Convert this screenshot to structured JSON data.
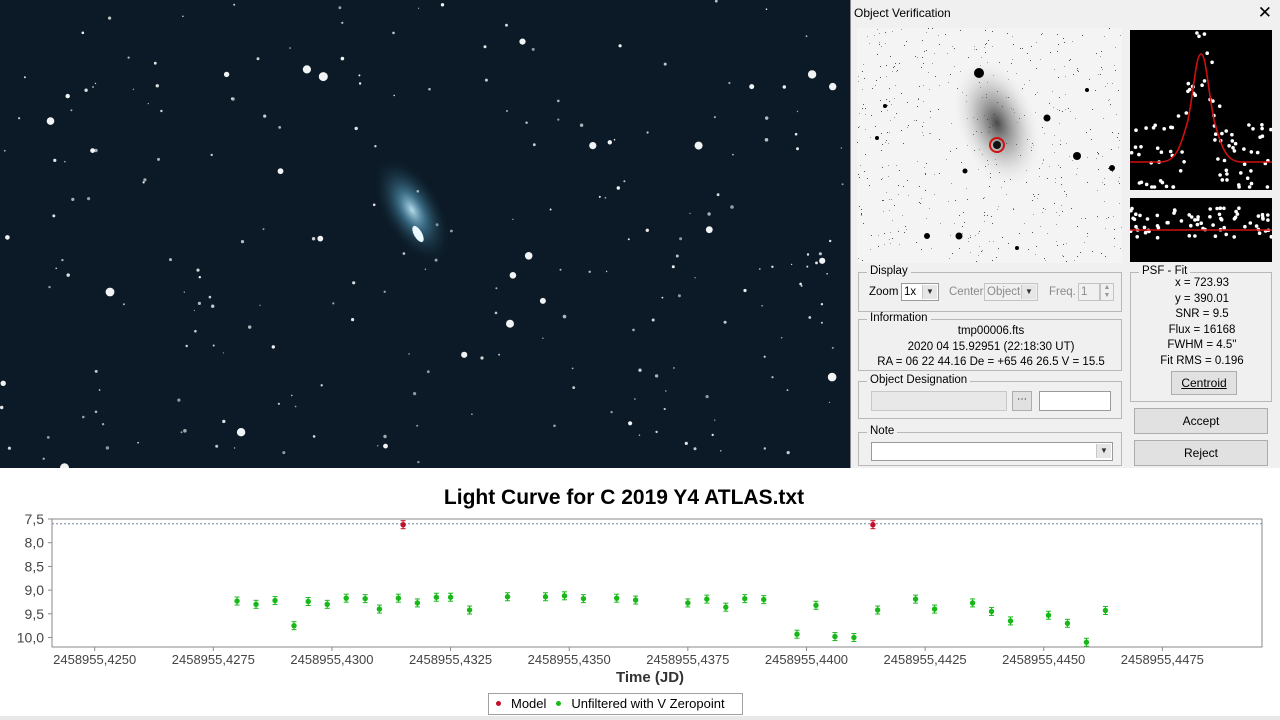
{
  "image": {
    "background_color": "#0b1a26",
    "star_color": "#ffffff",
    "comet_color": "#8fc6de"
  },
  "dialog": {
    "title": "Object Verification",
    "close_icon": "close-icon",
    "display": {
      "label": "Display",
      "zoom_label": "Zoom",
      "zoom_value": "1x",
      "center_label": "Center",
      "center_value": "Object",
      "freq_label": "Freq.",
      "freq_value": "1"
    },
    "information": {
      "label": "Information",
      "filename": "tmp00006.fts",
      "datetime": "2020 04 15.92951 (22:18:30 UT)",
      "coords": "RA = 06 22 44.16   De = +65 46 26.5   V = 15.5"
    },
    "designation": {
      "label": "Object Designation",
      "value": "",
      "browse_icon": "browse-icon",
      "extra_value": ""
    },
    "note": {
      "label": "Note",
      "value": ""
    },
    "psf": {
      "label": "PSF - Fit",
      "x": "x = 723.93",
      "y": "y = 390.01",
      "snr": "SNR = 9.5",
      "flux": "Flux = 16168",
      "fwhm": "FWHM = 4.5''",
      "fit_rms": "Fit RMS = 0.196",
      "centroid_button": "Centroid"
    },
    "accept_button": "Accept",
    "reject_button": "Reject"
  },
  "chart_data": {
    "type": "scatter",
    "title": "Light Curve for C 2019  Y4 ATLAS.txt",
    "xlabel": "Time (JD)",
    "ylabel": "",
    "x_tick_labels": [
      "2458955,4250",
      "2458955,4275",
      "2458955,4300",
      "2458955,4325",
      "2458955,4350",
      "2458955,4375",
      "2458955,4400",
      "2458955,4425",
      "2458955,4450",
      "2458955,4475"
    ],
    "y_tick_labels": [
      "7,5",
      "8,0",
      "8,5",
      "9,0",
      "9,5",
      "10,0"
    ],
    "x_ticks": [
      2458955.425,
      2458955.4275,
      2458955.43,
      2458955.4325,
      2458955.435,
      2458955.4375,
      2458955.44,
      2458955.4425,
      2458955.445,
      2458955.4475
    ],
    "y_ticks": [
      7.5,
      8.0,
      8.5,
      9.0,
      9.5,
      10.0
    ],
    "xlim": [
      2458955.4241,
      2458955.4496
    ],
    "ylim": [
      7.5,
      10.2
    ],
    "y_inverted": true,
    "grid": false,
    "reference_line": 7.6,
    "legend_position": "bottom-center",
    "series": [
      {
        "name": "Model",
        "color": "#c0102a",
        "points": [
          {
            "x": 2458955.4315,
            "y": 7.62
          },
          {
            "x": 2458955.4414,
            "y": 7.62
          }
        ]
      },
      {
        "name": "Unfiltered with V Zeropoint",
        "color": "#18b818",
        "points": [
          {
            "x": 2458955.428,
            "y": 9.23
          },
          {
            "x": 2458955.4284,
            "y": 9.3
          },
          {
            "x": 2458955.4288,
            "y": 9.22
          },
          {
            "x": 2458955.4292,
            "y": 9.75
          },
          {
            "x": 2458955.4295,
            "y": 9.24
          },
          {
            "x": 2458955.4299,
            "y": 9.3
          },
          {
            "x": 2458955.4303,
            "y": 9.17
          },
          {
            "x": 2458955.4307,
            "y": 9.18
          },
          {
            "x": 2458955.431,
            "y": 9.4
          },
          {
            "x": 2458955.4314,
            "y": 9.17
          },
          {
            "x": 2458955.4318,
            "y": 9.27
          },
          {
            "x": 2458955.4322,
            "y": 9.15
          },
          {
            "x": 2458955.4325,
            "y": 9.15
          },
          {
            "x": 2458955.4329,
            "y": 9.42
          },
          {
            "x": 2458955.4337,
            "y": 9.14
          },
          {
            "x": 2458955.4345,
            "y": 9.14
          },
          {
            "x": 2458955.4349,
            "y": 9.12
          },
          {
            "x": 2458955.4353,
            "y": 9.18
          },
          {
            "x": 2458955.436,
            "y": 9.17
          },
          {
            "x": 2458955.4364,
            "y": 9.21
          },
          {
            "x": 2458955.4375,
            "y": 9.27
          },
          {
            "x": 2458955.4379,
            "y": 9.19
          },
          {
            "x": 2458955.4383,
            "y": 9.36
          },
          {
            "x": 2458955.4387,
            "y": 9.18
          },
          {
            "x": 2458955.4391,
            "y": 9.2
          },
          {
            "x": 2458955.4398,
            "y": 9.93
          },
          {
            "x": 2458955.4402,
            "y": 9.32
          },
          {
            "x": 2458955.4406,
            "y": 9.98
          },
          {
            "x": 2458955.441,
            "y": 10.0
          },
          {
            "x": 2458955.4415,
            "y": 9.42
          },
          {
            "x": 2458955.4423,
            "y": 9.19
          },
          {
            "x": 2458955.4427,
            "y": 9.4
          },
          {
            "x": 2458955.4435,
            "y": 9.27
          },
          {
            "x": 2458955.4439,
            "y": 9.45
          },
          {
            "x": 2458955.4443,
            "y": 9.65
          },
          {
            "x": 2458955.4451,
            "y": 9.53
          },
          {
            "x": 2458955.4455,
            "y": 9.7
          },
          {
            "x": 2458955.4459,
            "y": 10.1
          },
          {
            "x": 2458955.4463,
            "y": 9.43
          }
        ]
      }
    ]
  }
}
